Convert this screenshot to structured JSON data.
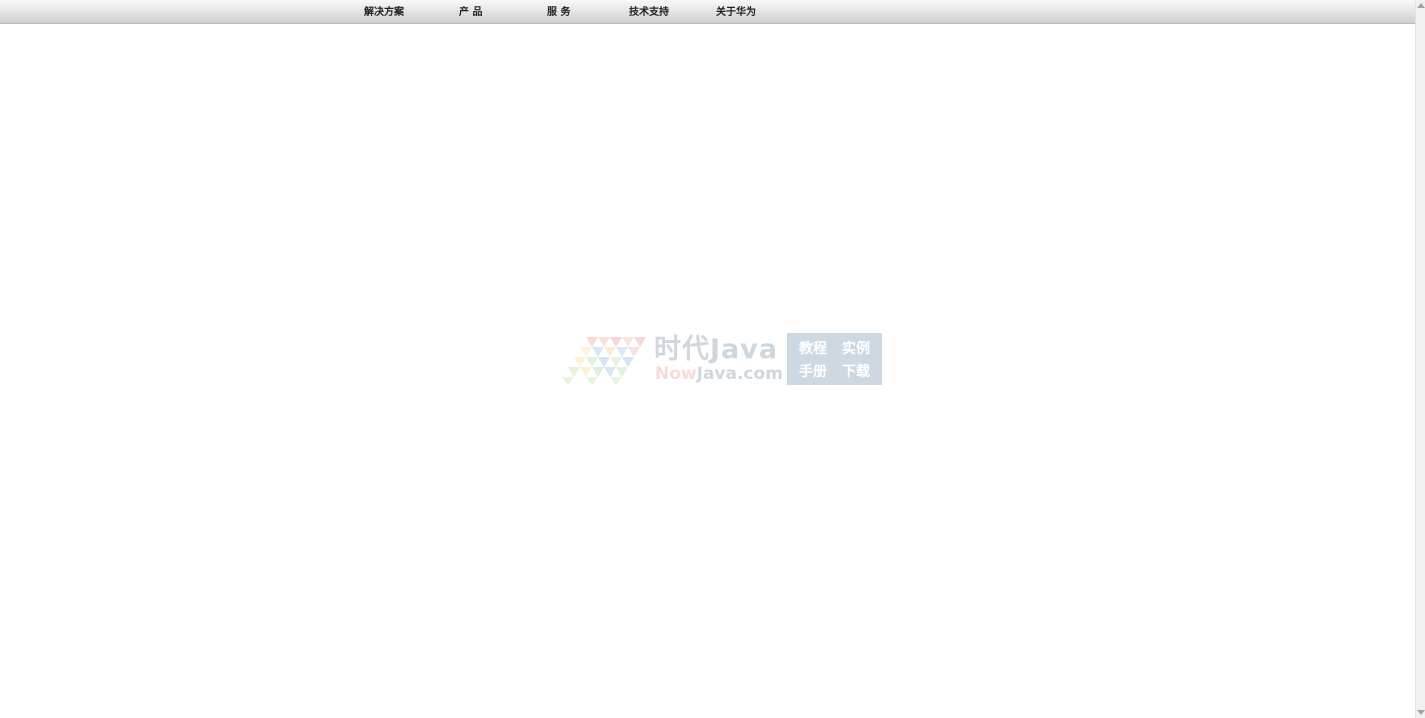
{
  "nav": {
    "items": [
      {
        "label": "解决方案"
      },
      {
        "label": "产 品"
      },
      {
        "label": "服 务"
      },
      {
        "label": "技术支持"
      },
      {
        "label": "关于华为"
      }
    ]
  },
  "watermark": {
    "title": "时代Java",
    "subtitle_accent": "Now",
    "subtitle_rest": "Java.com",
    "box_labels": [
      "教程",
      "实例",
      "手册",
      "下载"
    ]
  },
  "colors": {
    "nav_text": "#222222",
    "watermark_text": "#8fa2b2",
    "watermark_accent": "#f0a89e",
    "watermark_box": "#8aa4b8"
  }
}
